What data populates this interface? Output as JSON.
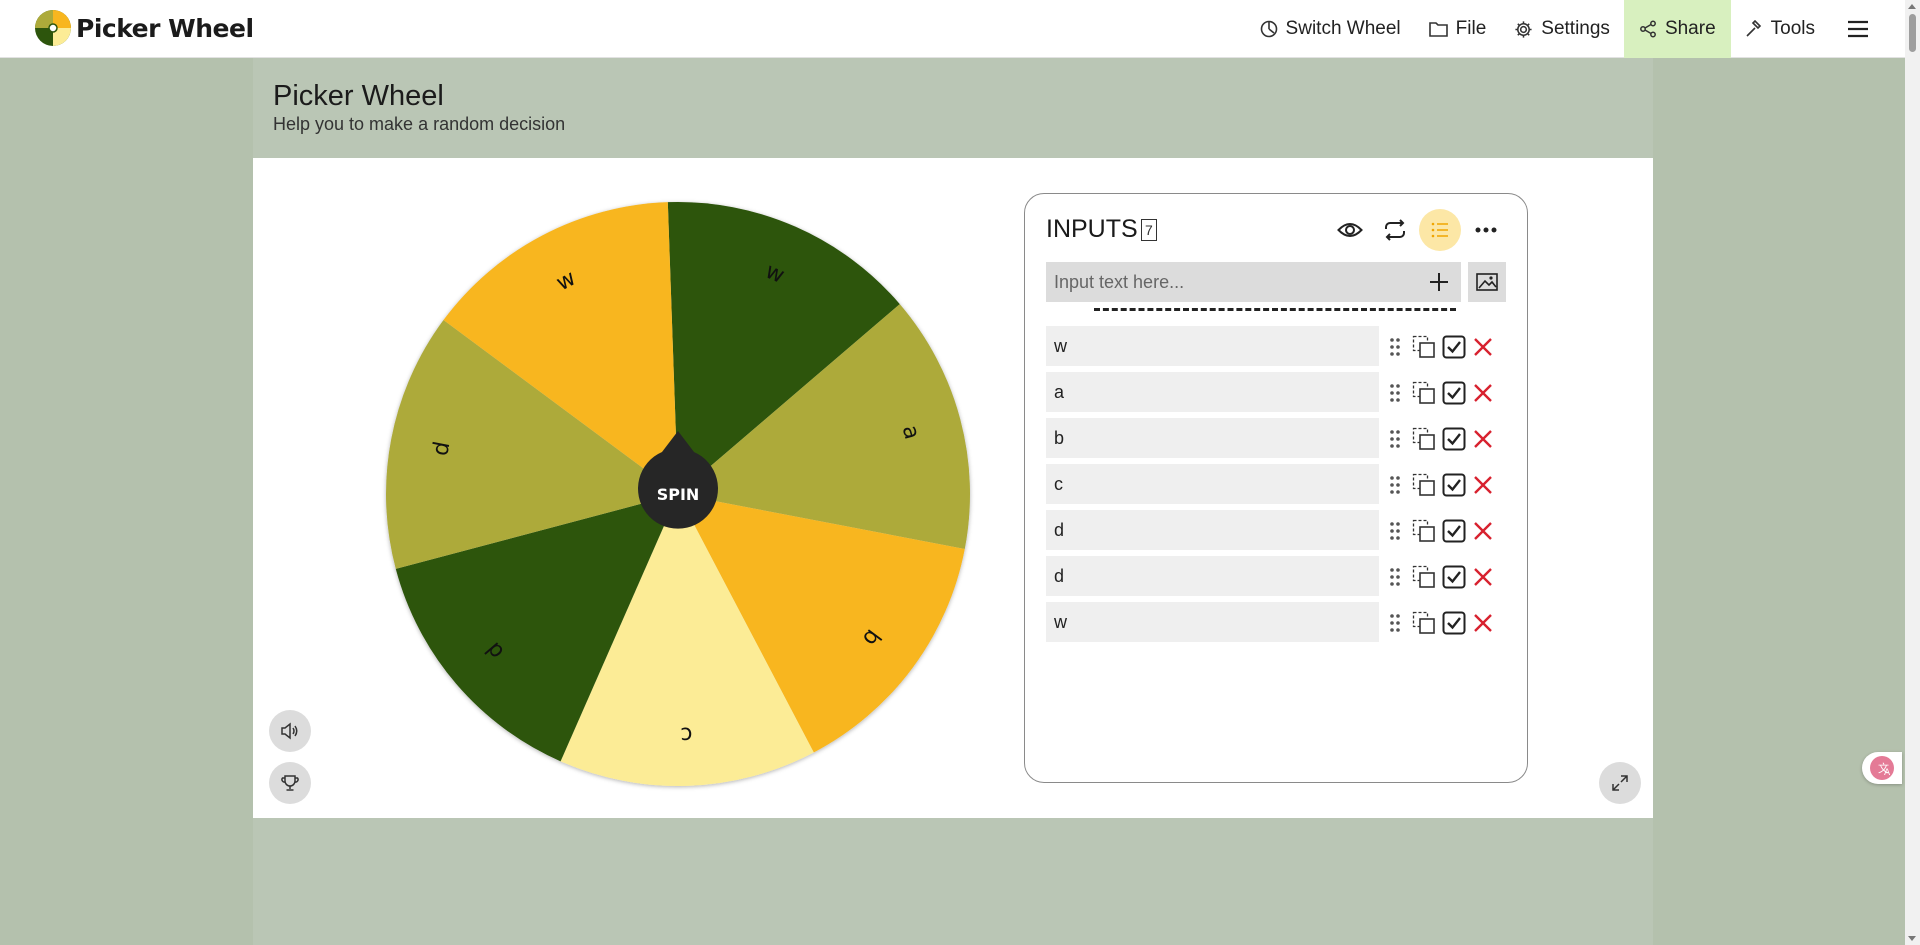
{
  "app": {
    "name": "Picker Wheel",
    "brand_colors": {
      "dark_green": "#2d550c",
      "olive": "#adaa3a",
      "amber": "#f8b61f",
      "pale_yellow": "#fcec96",
      "share_bg": "#d8f0bf"
    }
  },
  "nav": {
    "switch_wheel": "Switch Wheel",
    "file": "File",
    "settings": "Settings",
    "share": "Share",
    "tools": "Tools"
  },
  "page": {
    "title": "Picker Wheel",
    "subtitle": "Help you to make a random decision"
  },
  "wheel": {
    "spin_label": "SPIN",
    "segments": [
      {
        "label": "w",
        "color": "#2d550c"
      },
      {
        "label": "a",
        "color": "#adaa3a"
      },
      {
        "label": "b",
        "color": "#f8b61f"
      },
      {
        "label": "c",
        "color": "#fcec96"
      },
      {
        "label": "d",
        "color": "#2d550c"
      },
      {
        "label": "d",
        "color": "#adaa3a"
      },
      {
        "label": "w",
        "color": "#f8b61f"
      }
    ]
  },
  "inputs": {
    "title": "INPUTS",
    "count": "7",
    "placeholder": "Input text here...",
    "entries": [
      "w",
      "a",
      "b",
      "c",
      "d",
      "d",
      "w"
    ]
  },
  "icons": [
    "switch-wheel-icon",
    "folder-icon",
    "gear-icon",
    "share-icon",
    "hammer-icon",
    "menu-icon",
    "eye-icon",
    "repeat-icon",
    "list-icon",
    "more-icon",
    "plus-icon",
    "image-icon",
    "drag-handle-icon",
    "duplicate-icon",
    "checkbox-icon",
    "delete-icon",
    "sound-icon",
    "trophy-icon",
    "fullscreen-icon",
    "translate-icon"
  ]
}
